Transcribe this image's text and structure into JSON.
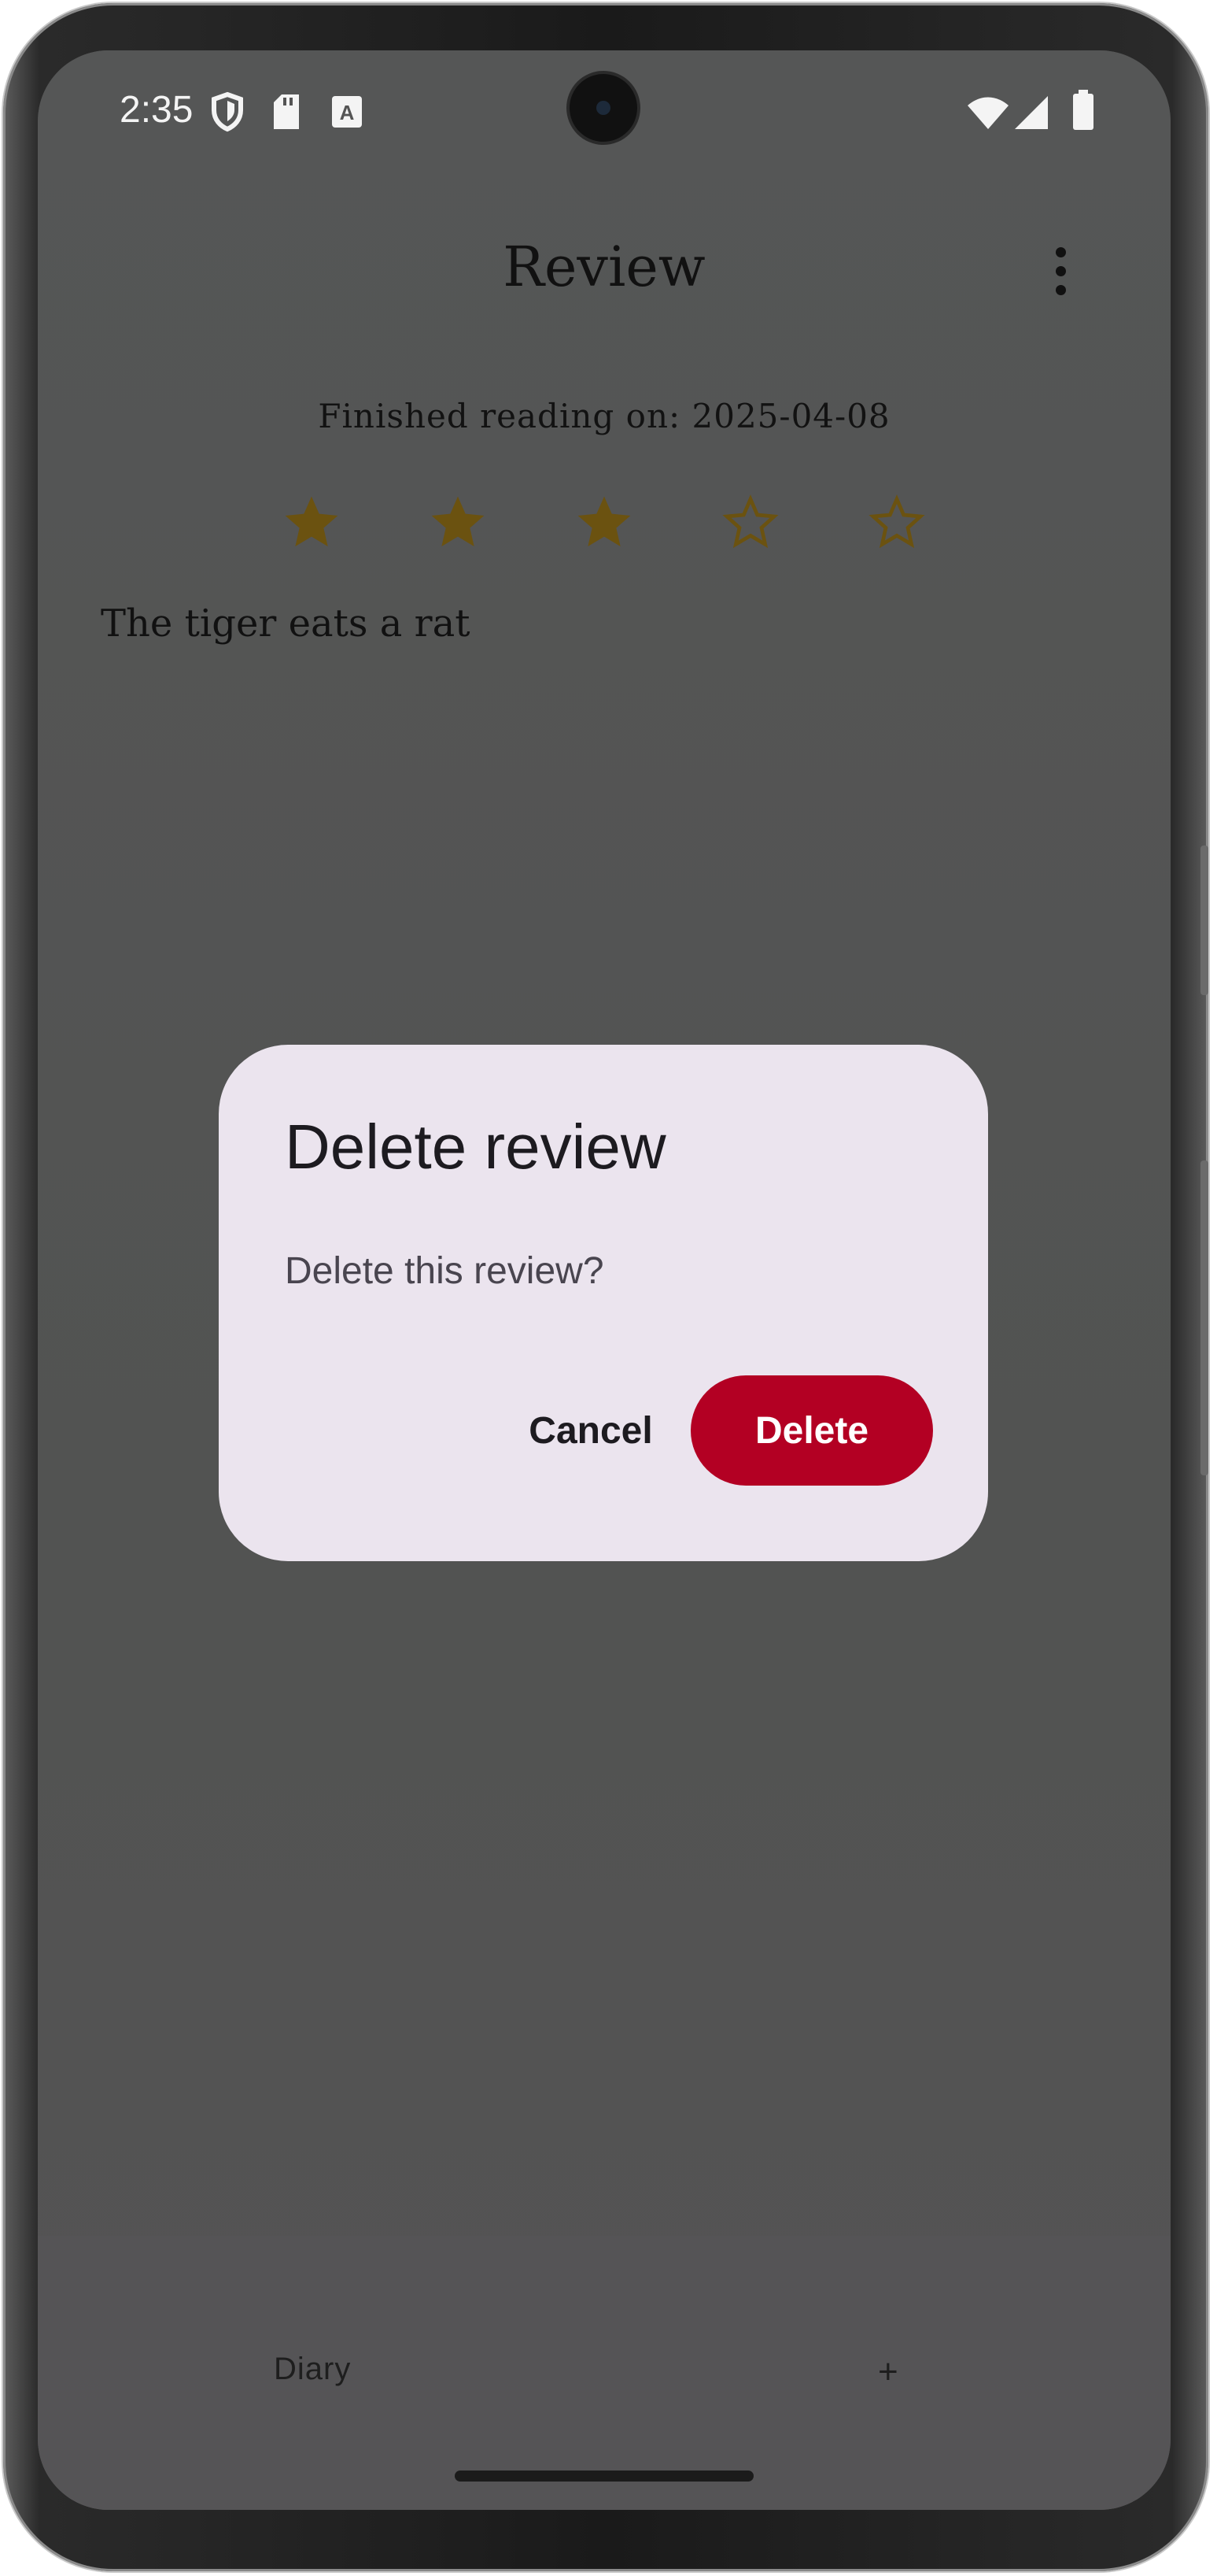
{
  "status_bar": {
    "time": "2:35",
    "icons": [
      "shield-icon",
      "sd-card-icon",
      "keyboard-a-icon",
      "wifi-icon",
      "signal-icon",
      "battery-icon"
    ]
  },
  "app_bar": {
    "title": "Review",
    "menu_icon": "more-vert-icon"
  },
  "review": {
    "finished_label": "Finished reading on: 2025-04-08",
    "rating": 3,
    "max_rating": 5,
    "text": "The tiger eats a rat"
  },
  "dialog": {
    "title": "Delete review",
    "message": "Delete this review?",
    "cancel_label": "Cancel",
    "delete_label": "Delete"
  },
  "bottom_nav": {
    "diary_label": "Diary",
    "add_label": "+"
  },
  "colors": {
    "star": "#6b5210",
    "delete_button": "#b30023",
    "dialog_bg": "#ebe4ee",
    "scrim": "#545454"
  }
}
